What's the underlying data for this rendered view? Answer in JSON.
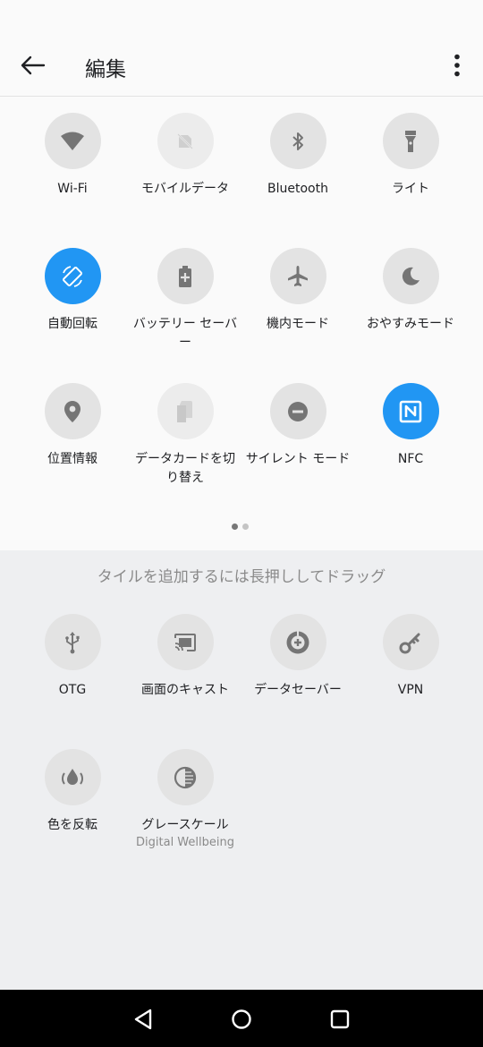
{
  "header": {
    "title": "編集"
  },
  "active_tiles": [
    {
      "label": "Wi-Fi",
      "icon": "wifi-icon",
      "state": "off"
    },
    {
      "label": "モバイルデータ",
      "icon": "mobile-data-off-icon",
      "state": "disabled"
    },
    {
      "label": "Bluetooth",
      "icon": "bluetooth-icon",
      "state": "off"
    },
    {
      "label": "ライト",
      "icon": "flashlight-icon",
      "state": "off"
    },
    {
      "label": "自動回転",
      "icon": "auto-rotate-icon",
      "state": "on"
    },
    {
      "label": "バッテリー セーバー",
      "icon": "battery-saver-icon",
      "state": "off"
    },
    {
      "label": "機内モード",
      "icon": "airplane-icon",
      "state": "off"
    },
    {
      "label": "おやすみモード",
      "icon": "moon-icon",
      "state": "off"
    },
    {
      "label": "位置情報",
      "icon": "location-pin-icon",
      "state": "off"
    },
    {
      "label": "データカードを切り替え",
      "icon": "sim-card-icon",
      "state": "disabled"
    },
    {
      "label": "サイレント モード",
      "icon": "do-not-disturb-icon",
      "state": "off"
    },
    {
      "label": "NFC",
      "icon": "nfc-icon",
      "state": "on"
    }
  ],
  "pager": {
    "pages": 2,
    "current": 1
  },
  "hint": "タイルを追加するには長押ししてドラッグ",
  "available_tiles": [
    {
      "label": "OTG",
      "icon": "usb-icon"
    },
    {
      "label": "画面のキャスト",
      "icon": "cast-icon"
    },
    {
      "label": "データセーバー",
      "icon": "data-saver-icon"
    },
    {
      "label": "VPN",
      "icon": "key-icon"
    },
    {
      "label": "色を反転",
      "icon": "invert-colors-icon"
    },
    {
      "label": "グレースケール",
      "sub": "Digital Wellbeing",
      "icon": "grayscale-icon"
    }
  ],
  "colors": {
    "accent": "#2196f3",
    "tile_off": "#e3e3e3",
    "available_bg": "#eeeff1"
  },
  "navbar": {
    "buttons": [
      "back-icon",
      "home-icon",
      "recents-icon"
    ]
  }
}
